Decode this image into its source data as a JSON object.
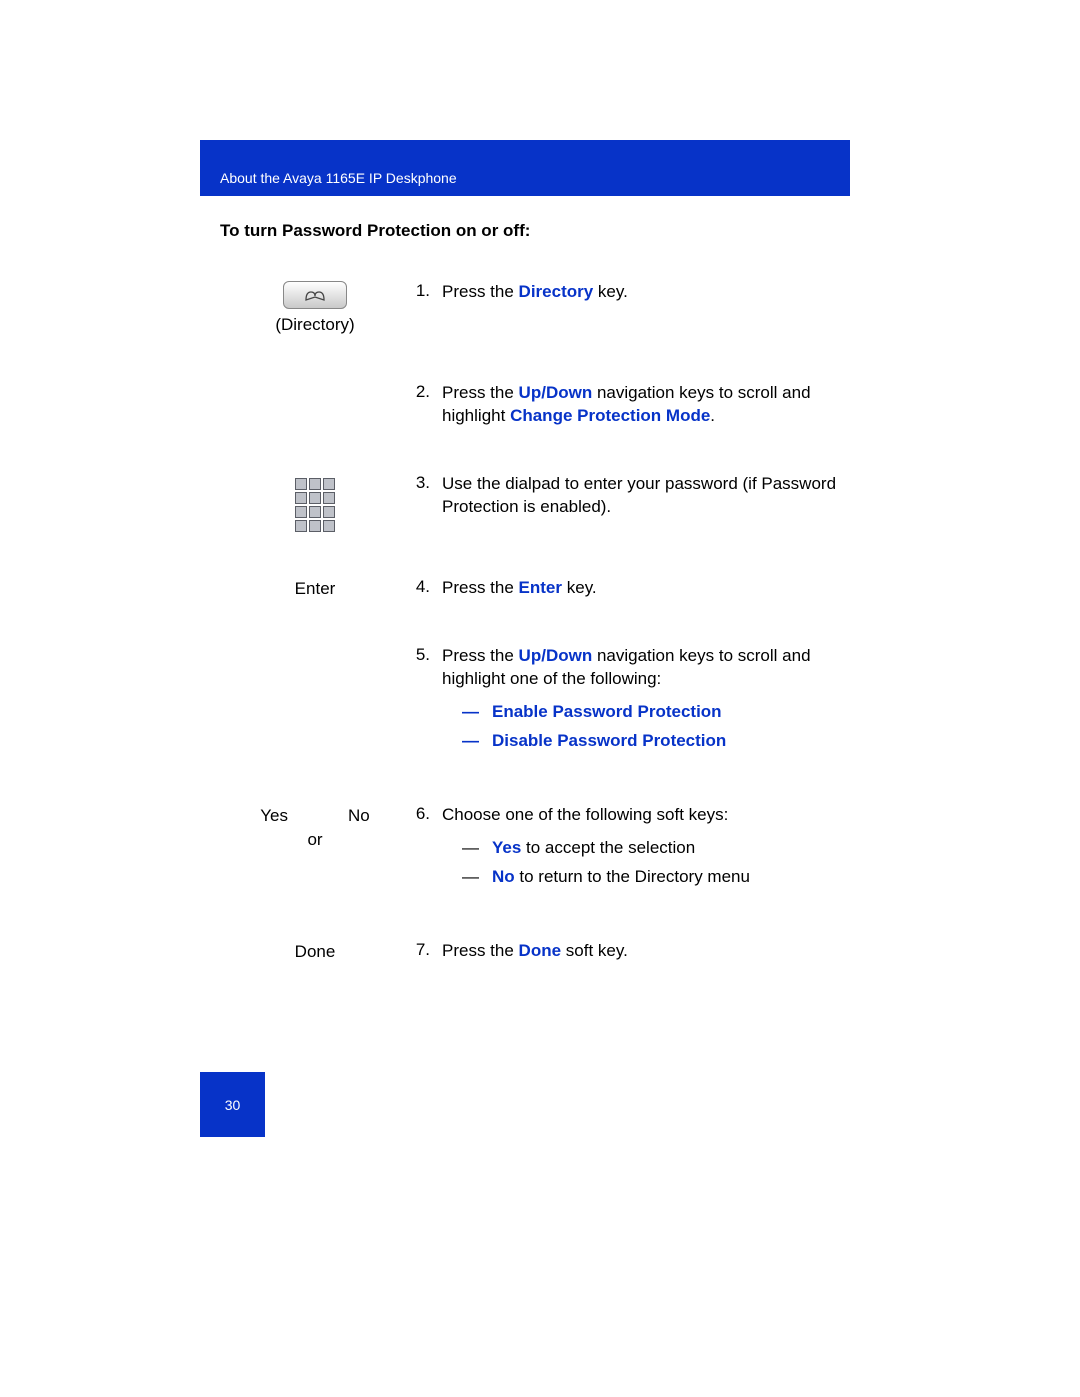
{
  "header": "About the Avaya 1165E IP Deskphone",
  "section_title": "To turn Password Protection on or off:",
  "left": {
    "directory": "(Directory)",
    "enter": "Enter",
    "yes": "Yes",
    "no": "No",
    "or": "or",
    "done": "Done"
  },
  "steps": {
    "s1": {
      "num": "1.",
      "pre": "Press the ",
      "kw": "Directory",
      "post": " key."
    },
    "s2": {
      "num": "2.",
      "pre": "Press the ",
      "kw1": "Up",
      "slash": "/",
      "kw2": "Down",
      "mid": " navigation keys to scroll and highlight ",
      "kw3": "Change Protection Mode",
      "post": "."
    },
    "s3": {
      "num": "3.",
      "text": "Use the dialpad to enter your password (if Password Protection is enabled)."
    },
    "s4": {
      "num": "4.",
      "pre": "Press the ",
      "kw": "Enter",
      "post": " key."
    },
    "s5": {
      "num": "5.",
      "pre": "Press the ",
      "kw1": "Up",
      "slash": "/",
      "kw2": "Down",
      "mid": " navigation keys to scroll and highlight one of the following:",
      "opt1": "Enable Password Protection",
      "opt2": "Disable Password Protection"
    },
    "s6": {
      "num": "6.",
      "text": "Choose one of the following soft keys:",
      "opt1kw": "Yes",
      "opt1txt": " to accept the selection",
      "opt2kw": "No",
      "opt2txt": " to return to the Directory menu"
    },
    "s7": {
      "num": "7.",
      "pre": "Press the ",
      "kw": "Done",
      "post": " soft key."
    }
  },
  "page_number": "30"
}
